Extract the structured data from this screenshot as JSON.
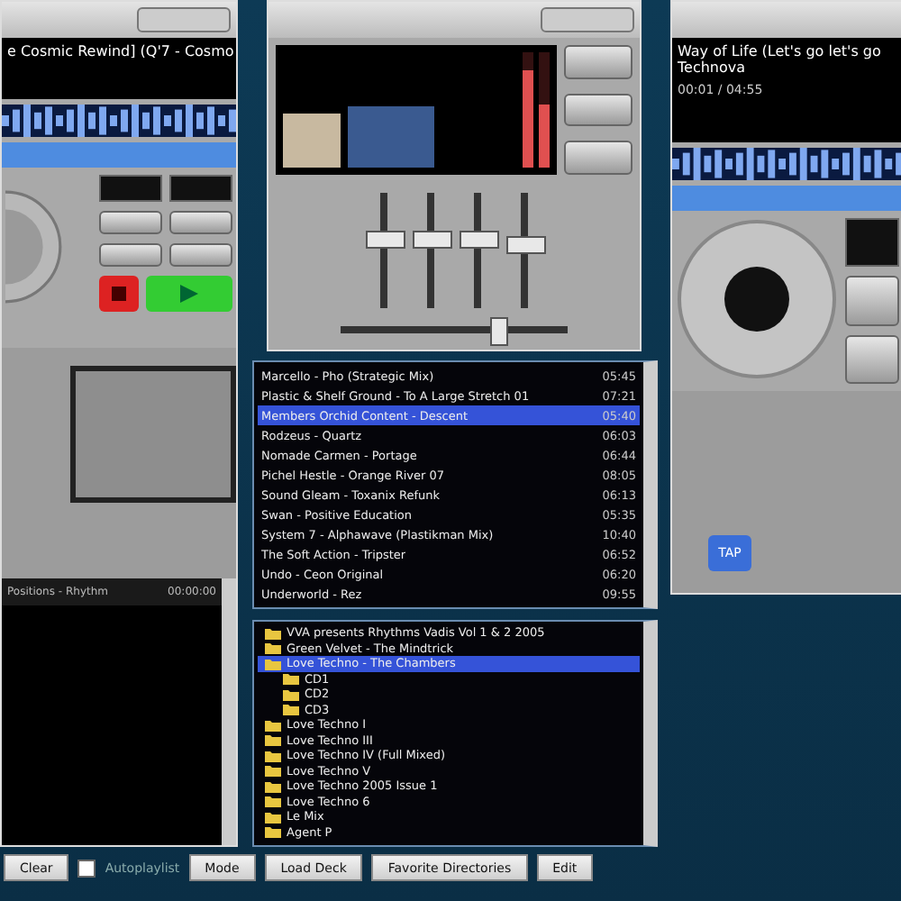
{
  "left_deck": {
    "track_title": "e Cosmic Rewind] (Q'7 - Cosmo",
    "browser_line": "Positions - Rhythm",
    "browser_time": "00:00:00"
  },
  "mixer": {
    "vu_levels": [
      {
        "level": 0.85
      },
      {
        "level": 0.55
      }
    ],
    "faders": [
      {
        "level": 0.6
      },
      {
        "level": 0.6
      },
      {
        "level": 0.6
      },
      {
        "level": 0.55
      }
    ],
    "crossfader": {
      "level": 0.7
    }
  },
  "right_deck": {
    "track_title": "Way of Life (Let's go let's go",
    "artist": "Technova",
    "time": "00:01 / 04:55",
    "tap_button": "TAP"
  },
  "playlist": {
    "rows": [
      {
        "title": "Marcello - Pho (Strategic Mix)",
        "time": "05:45",
        "selected": false
      },
      {
        "title": "Plastic & Shelf Ground - To A Large Stretch 01",
        "time": "07:21",
        "selected": false
      },
      {
        "title": "Members Orchid Content - Descent",
        "time": "05:40",
        "selected": true
      },
      {
        "title": "Rodzeus - Quartz",
        "time": "06:03",
        "selected": false
      },
      {
        "title": "Nomade Carmen - Portage",
        "time": "06:44",
        "selected": false
      },
      {
        "title": "Pichel Hestle - Orange River 07",
        "time": "08:05",
        "selected": false
      },
      {
        "title": "Sound Gleam - Toxanix Refunk",
        "time": "06:13",
        "selected": false
      },
      {
        "title": "Swan - Positive Education",
        "time": "05:35",
        "selected": false
      },
      {
        "title": "System 7 - Alphawave (Plastikman Mix)",
        "time": "10:40",
        "selected": false
      },
      {
        "title": "The Soft Action - Tripster",
        "time": "06:52",
        "selected": false
      },
      {
        "title": "Undo - Ceon Original",
        "time": "06:20",
        "selected": false
      },
      {
        "title": "Underworld - Rez",
        "time": "09:55",
        "selected": false
      }
    ]
  },
  "folders": [
    {
      "name": "VVA presents Rhythms Vadis Vol 1 & 2 2005",
      "selected": false
    },
    {
      "name": "Green Velvet - The Mindtrick",
      "selected": false
    },
    {
      "name": "Love Techno - The Chambers",
      "selected": true,
      "children": [
        {
          "name": "CD1",
          "selected": false
        },
        {
          "name": "CD2",
          "selected": false
        },
        {
          "name": "CD3",
          "selected": false
        }
      ]
    },
    {
      "name": "Love Techno I",
      "selected": false
    },
    {
      "name": "Love Techno III",
      "selected": false
    },
    {
      "name": "Love Techno IV (Full Mixed)",
      "selected": false
    },
    {
      "name": "Love Techno V",
      "selected": false
    },
    {
      "name": "Love Techno 2005 Issue 1",
      "selected": false
    },
    {
      "name": "Love Techno 6",
      "selected": false
    },
    {
      "name": "Le Mix",
      "selected": false
    },
    {
      "name": "Agent P",
      "selected": false
    }
  ],
  "bottom_bar": {
    "clear_button": "Clear",
    "autoplaylist": {
      "label": "Autoplaylist",
      "checked": false
    },
    "buttons": [
      "Mode",
      "Load Deck",
      "Favorite Directories",
      "Edit"
    ]
  }
}
